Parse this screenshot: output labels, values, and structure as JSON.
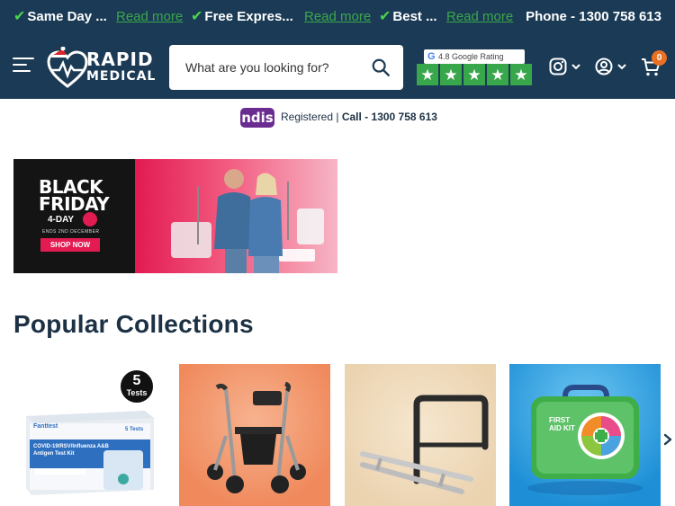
{
  "promo_bar": {
    "items": [
      {
        "text": "Same Day ...",
        "link": "Read more"
      },
      {
        "text": "Free Expres...",
        "link": "Read more"
      },
      {
        "text": "Best ...",
        "link": "Read more"
      }
    ],
    "phone": "Phone - 1300 758 613",
    "check_color": "#4cd34c"
  },
  "header": {
    "logo_line1": "RAPID",
    "logo_line2": "MEDICAL",
    "search_placeholder": "What are you looking for?",
    "rating_label": "4.8 Google Rating",
    "rating_google_letter": "G",
    "rating_stars": 5,
    "cart_count": "0",
    "icons": [
      "menu-icon",
      "search-icon",
      "instagram-icon",
      "chevron-down-icon",
      "account-icon",
      "cart-icon"
    ]
  },
  "ndis": {
    "logo": "ndis",
    "registered": "Registered",
    "separator": "|",
    "call": "Call - 1300 758 613"
  },
  "banner": {
    "line1": "BLACK",
    "line2": "FRIDAY",
    "sale": "4-DAY",
    "ends": "ENDS 2ND DECEMBER",
    "cta": "SHOP NOW"
  },
  "collections": {
    "title": "Popular Collections",
    "cards": [
      {
        "badge_number": "5",
        "badge_word": "Tests",
        "brand": "Fanttest",
        "product_line": "COVID-19/RSV/Influenza A&B",
        "product_line2": "Antigen Test Kit",
        "box_count": "5 Tests"
      },
      {
        "name": "rollator"
      },
      {
        "name": "bed-rail"
      },
      {
        "kit_title": "FIRST AID KIT"
      }
    ]
  },
  "colors": {
    "header_bg": "#1b3a55",
    "accent_green": "#38a64a",
    "cart_badge": "#ea7024",
    "ndis_purple": "#6b2c91",
    "title_text": "#1c3144"
  }
}
